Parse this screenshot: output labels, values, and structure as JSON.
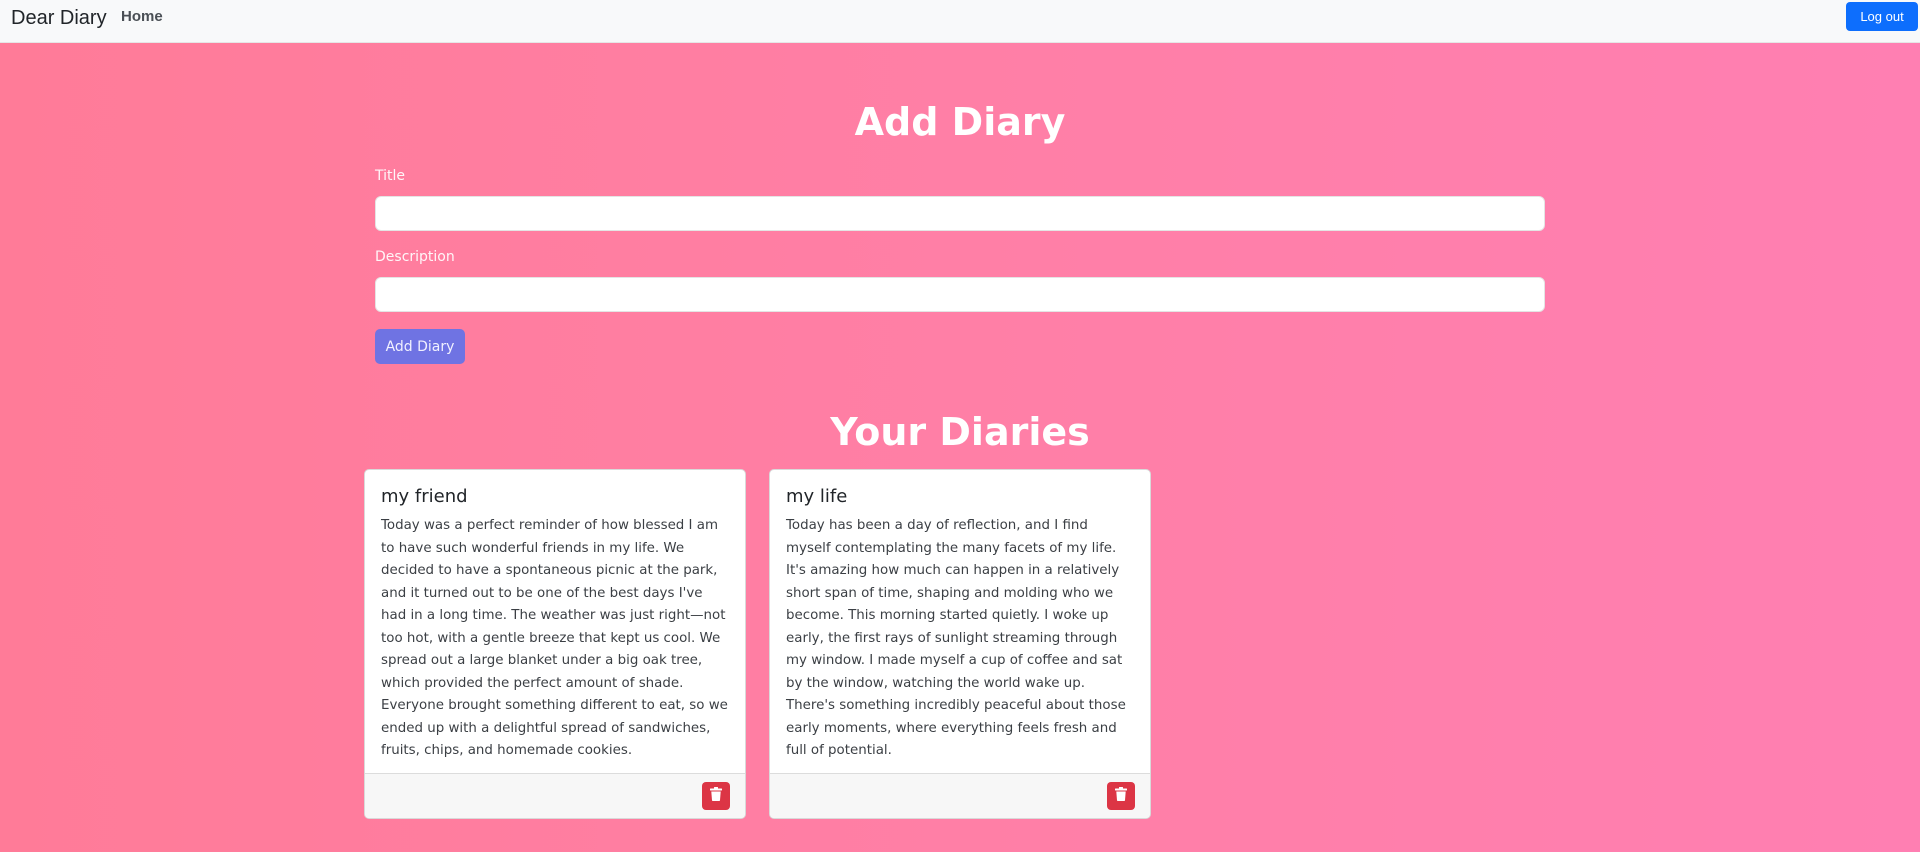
{
  "navbar": {
    "brand": "Dear Diary",
    "home_label": "Home",
    "logout_label": "Log out"
  },
  "form": {
    "heading": "Add Diary",
    "title_label": "Title",
    "title_value": "",
    "description_label": "Description",
    "description_value": "",
    "submit_label": "Add Diary"
  },
  "diaries": {
    "heading": "Your Diaries",
    "items": [
      {
        "title": "my friend",
        "text": "Today was a perfect reminder of how blessed I am to have such wonderful friends in my life. We decided to have a spontaneous picnic at the park, and it turned out to be one of the best days I've had in a long time. The weather was just right—not too hot, with a gentle breeze that kept us cool. We spread out a large blanket under a big oak tree, which provided the perfect amount of shade. Everyone brought something different to eat, so we ended up with a delightful spread of sandwiches, fruits, chips, and homemade cookies."
      },
      {
        "title": "my life",
        "text": "Today has been a day of reflection, and I find myself contemplating the many facets of my life. It's amazing how much can happen in a relatively short span of time, shaping and molding who we become. This morning started quietly. I woke up early, the first rays of sunlight streaming through my window. I made myself a cup of coffee and sat by the window, watching the world wake up. There's something incredibly peaceful about those early moments, where everything feels fresh and full of potential."
      }
    ]
  },
  "colors": {
    "background_start": "#ff7b98",
    "background_end": "#ff7fb2",
    "primary": "#0d6efd",
    "add_button": "#6f73e3",
    "danger": "#dc3545"
  },
  "icons": {
    "delete": "trash-icon"
  }
}
